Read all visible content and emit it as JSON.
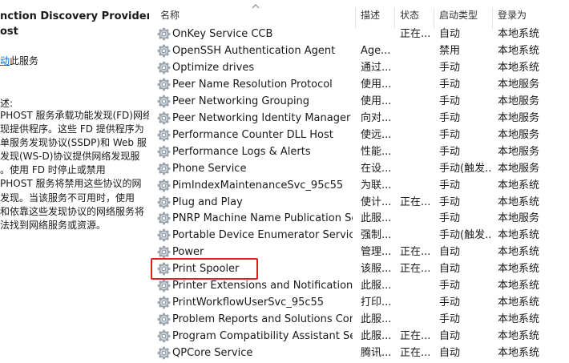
{
  "detail": {
    "title_lines": [
      "nction Discovery Provider",
      "ost"
    ],
    "start_link": "动",
    "start_suffix": "此服务",
    "desc_label": "述:",
    "desc_lines": [
      "PHOST 服务承载功能发现(FD)网络",
      "现提供程序。这些 FD 提供程序为",
      "单服务发现协议(SSDP)和 Web 服",
      "发现(WS-D)协议提供网络发现服",
      "。使用 FD 时停止或禁用",
      "PHOST 服务将禁用这些协议的网",
      "发现。当该服务不可用时，使用",
      "和依靠这些发现协议的网络服务将",
      "法找到网络服务或资源。"
    ]
  },
  "columns": {
    "name": "名称",
    "description": "描述",
    "status": "状态",
    "startup_type": "启动类型",
    "log_on_as": "登录为"
  },
  "icons": {
    "service": "gear-icon",
    "sort": "sort-ascending-icon"
  },
  "highlight_color": "#e02020",
  "services": [
    {
      "name": "OnKey Service CCB",
      "desc": "",
      "status": "正在...",
      "startup": "自动",
      "logon": "本地系统"
    },
    {
      "name": "OpenSSH Authentication Agent",
      "desc": "Age...",
      "status": "",
      "startup": "禁用",
      "logon": "本地系统"
    },
    {
      "name": "Optimize drives",
      "desc": "通过...",
      "status": "",
      "startup": "手动",
      "logon": "本地系统"
    },
    {
      "name": "Peer Name Resolution Protocol",
      "desc": "使用...",
      "status": "",
      "startup": "手动",
      "logon": "本地服务"
    },
    {
      "name": "Peer Networking Grouping",
      "desc": "使用...",
      "status": "",
      "startup": "手动",
      "logon": "本地服务"
    },
    {
      "name": "Peer Networking Identity Manager",
      "desc": "向对...",
      "status": "",
      "startup": "手动",
      "logon": "本地服务"
    },
    {
      "name": "Performance Counter DLL Host",
      "desc": "使远...",
      "status": "",
      "startup": "手动",
      "logon": "本地服务"
    },
    {
      "name": "Performance Logs & Alerts",
      "desc": "性能...",
      "status": "",
      "startup": "手动",
      "logon": "本地服务"
    },
    {
      "name": "Phone Service",
      "desc": "在设...",
      "status": "",
      "startup": "手动(触发...",
      "logon": "本地服务"
    },
    {
      "name": "PimIndexMaintenanceSvc_95c55",
      "desc": "为联...",
      "status": "",
      "startup": "手动",
      "logon": "本地系统"
    },
    {
      "name": "Plug and Play",
      "desc": "使计...",
      "status": "正在...",
      "startup": "手动",
      "logon": "本地系统"
    },
    {
      "name": "PNRP Machine Name Publication Ser...",
      "desc": "此服...",
      "status": "",
      "startup": "手动",
      "logon": "本地服务"
    },
    {
      "name": "Portable Device Enumerator Service",
      "desc": "强制...",
      "status": "",
      "startup": "手动(触发...",
      "logon": "本地系统"
    },
    {
      "name": "Power",
      "desc": "管理...",
      "status": "正在...",
      "startup": "自动",
      "logon": "本地系统"
    },
    {
      "name": "Print Spooler",
      "desc": "该服...",
      "status": "正在...",
      "startup": "自动",
      "logon": "本地系统"
    },
    {
      "name": "Printer Extensions and Notifications",
      "desc": "此服...",
      "status": "",
      "startup": "手动",
      "logon": "本地系统"
    },
    {
      "name": "PrintWorkflowUserSvc_95c55",
      "desc": "打印...",
      "status": "",
      "startup": "手动",
      "logon": "本地系统"
    },
    {
      "name": "Problem Reports and Solutions Contr...",
      "desc": "此服...",
      "status": "",
      "startup": "手动",
      "logon": "本地系统"
    },
    {
      "name": "Program Compatibility Assistant Servi...",
      "desc": "此服...",
      "status": "正在...",
      "startup": "自动",
      "logon": "本地系统"
    },
    {
      "name": "QPCore Service",
      "desc": "腾讯...",
      "status": "正在...",
      "startup": "自动",
      "logon": "本地系统"
    }
  ]
}
